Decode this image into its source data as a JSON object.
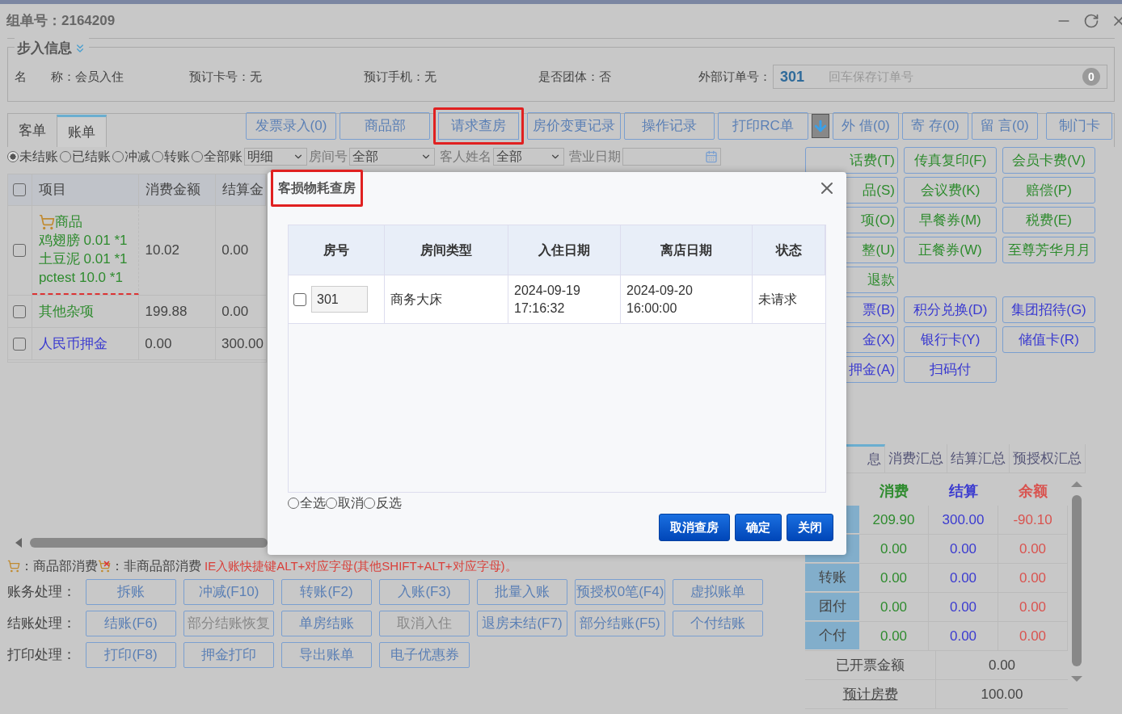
{
  "window": {
    "title": "组单号：2164209"
  },
  "info": {
    "legend": "步入信息",
    "fields": [
      {
        "label": "名　　称：",
        "value": "会员入住"
      },
      {
        "label": "预订卡号：",
        "value": "无"
      },
      {
        "label": "预订手机：",
        "value": "无"
      },
      {
        "label": "是否团体：",
        "value": "否"
      }
    ],
    "external_order": {
      "label": "外部订单号：",
      "room": "301",
      "placeholder": "回车保存订单号",
      "count": "0"
    }
  },
  "tabs": [
    {
      "label": "客单",
      "selected": false
    },
    {
      "label": "账单",
      "selected": true
    }
  ],
  "toolbar": [
    {
      "label": "发票录入(0)",
      "highlighted": false
    },
    {
      "label": "商品部",
      "highlighted": false
    },
    {
      "label": "请求查房",
      "highlighted": true
    },
    {
      "label": "房价变更记录",
      "highlighted": false
    },
    {
      "label": "操作记录",
      "highlighted": false
    },
    {
      "label": "打印RC单",
      "highlighted": false
    }
  ],
  "toolbar_right": [
    "外 借(0)",
    "寄 存(0)",
    "留 言(0)",
    "制门卡"
  ],
  "filters": {
    "radios": [
      {
        "label": "未结账",
        "selected": true
      },
      {
        "label": "已结账",
        "selected": false
      },
      {
        "label": "冲减",
        "selected": false
      },
      {
        "label": "转账",
        "selected": false
      },
      {
        "label": "全部账",
        "selected": false
      }
    ],
    "view": "明细",
    "room_label": "房间号",
    "room": "全部",
    "guest_label": "客人姓名",
    "guest": "全部",
    "date_label": "营业日期"
  },
  "bill_table": {
    "header_checked": false,
    "columns": [
      "项目",
      "消费金额",
      "结算金"
    ],
    "rows": [
      {
        "checked": false,
        "kind": "goods",
        "color": "#2e8b2e",
        "group": "商品",
        "lines": [
          "鸡翅膀 0.01 *1",
          "土豆泥 0.01 *1",
          "pctest 10.0 *1"
        ],
        "amount": "10.02",
        "settled": "0.00"
      },
      {
        "checked": false,
        "kind": "plain",
        "color": "#2e8b2e",
        "lines": [
          "其他杂项"
        ],
        "amount": "199.88",
        "settled": "0.00"
      },
      {
        "checked": false,
        "kind": "plain",
        "color": "#3a3ad0",
        "lines": [
          "人民币押金"
        ],
        "amount": "0.00",
        "settled": "300.00"
      }
    ]
  },
  "legend": {
    "goods": "：商品部消费",
    "non_goods": "：非商品部消费",
    "hint": "IE入账快捷键ALT+对应字母(其他SHIFT+ALT+对应字母)。"
  },
  "action_rows": [
    {
      "label": "账务处理：",
      "buttons": [
        {
          "label": "拆账",
          "disabled": false
        },
        {
          "label": "冲减(F10)",
          "disabled": false
        },
        {
          "label": "转账(F2)",
          "disabled": false
        },
        {
          "label": "入账(F3)",
          "disabled": false
        },
        {
          "label": "批量入账",
          "disabled": false
        },
        {
          "label": "预授权0笔(F4)",
          "disabled": false
        },
        {
          "label": "虚拟账单",
          "disabled": false
        }
      ]
    },
    {
      "label": "结账处理：",
      "buttons": [
        {
          "label": "结账(F6)",
          "disabled": false
        },
        {
          "label": "部分结账恢复",
          "disabled": true
        },
        {
          "label": "单房结账",
          "disabled": false
        },
        {
          "label": "取消入住",
          "disabled": true
        },
        {
          "label": "退房未结(F7)",
          "disabled": false
        },
        {
          "label": "部分结账(F5)",
          "disabled": false
        },
        {
          "label": "个付结账",
          "disabled": false
        }
      ]
    },
    {
      "label": "打印处理：",
      "buttons": [
        {
          "label": "打印(F8)",
          "disabled": false
        },
        {
          "label": "押金打印",
          "disabled": false
        },
        {
          "label": "导出账单",
          "disabled": false
        },
        {
          "label": "电子优惠券",
          "disabled": false
        }
      ]
    }
  ],
  "quick_buttons": [
    [
      {
        "label": "话费(T)",
        "kind": "charge"
      },
      {
        "label": "传真复印(F)",
        "kind": "charge"
      },
      {
        "label": "会员卡费(V)",
        "kind": "charge"
      }
    ],
    [
      {
        "label": "品(S)",
        "kind": "charge"
      },
      {
        "label": "会议费(K)",
        "kind": "charge"
      },
      {
        "label": "赔偿(P)",
        "kind": "charge"
      }
    ],
    [
      {
        "label": "项(O)",
        "kind": "charge"
      },
      {
        "label": "早餐券(M)",
        "kind": "charge"
      },
      {
        "label": "税费(E)",
        "kind": "charge"
      }
    ],
    [
      {
        "label": "整(U)",
        "kind": "charge"
      },
      {
        "label": "正餐券(W)",
        "kind": "charge"
      },
      {
        "label": "至尊芳华月月",
        "kind": "charge"
      }
    ],
    [
      {
        "label": "退款",
        "kind": "charge"
      }
    ],
    [
      {
        "label": "票(B)",
        "kind": "payment"
      },
      {
        "label": "积分兑换(D)",
        "kind": "payment"
      },
      {
        "label": "集团招待(G)",
        "kind": "payment"
      }
    ],
    [
      {
        "label": "金(X)",
        "kind": "payment"
      },
      {
        "label": "银行卡(Y)",
        "kind": "payment"
      },
      {
        "label": "储值卡(R)",
        "kind": "payment"
      }
    ],
    [
      {
        "label": "押金(A)",
        "kind": "payment"
      },
      {
        "label": "扫码付",
        "kind": "payment"
      }
    ]
  ],
  "summary": {
    "tabs": [
      {
        "label": "息",
        "selected": true
      },
      {
        "label": "消费汇总",
        "selected": false
      },
      {
        "label": "结算汇总",
        "selected": false
      },
      {
        "label": "预授权汇总",
        "selected": false
      }
    ],
    "columns": [
      "消费",
      "结算",
      "余额"
    ],
    "rows": [
      {
        "cells": [
          "209.90",
          "300.00",
          "-90.10"
        ]
      },
      {
        "cells": [
          "0.00",
          "0.00",
          "0.00"
        ]
      },
      {
        "label": "转账",
        "cells": [
          "0.00",
          "0.00",
          "0.00"
        ]
      },
      {
        "label": "团付",
        "cells": [
          "0.00",
          "0.00",
          "0.00"
        ]
      },
      {
        "label": "个付",
        "cells": [
          "0.00",
          "0.00",
          "0.00"
        ]
      }
    ],
    "totals": [
      {
        "label": "已开票金额",
        "value": "0.00",
        "link": false
      },
      {
        "label": "预计房费",
        "value": "100.00",
        "link": true
      }
    ]
  },
  "dialog": {
    "title": "客损物耗查房",
    "title_highlighted": true,
    "columns": [
      "房号",
      "房间类型",
      "入住日期",
      "离店日期",
      "状态"
    ],
    "rows": [
      {
        "checked": false,
        "room": "301",
        "type": "商务大床",
        "checkin": [
          "2024-09-19",
          "17:16:32"
        ],
        "checkout": [
          "2024-09-20",
          "16:00:00"
        ],
        "status": "未请求"
      }
    ],
    "radios": [
      {
        "label": "全选",
        "selected": false
      },
      {
        "label": "取消",
        "selected": false
      },
      {
        "label": "反选",
        "selected": false
      }
    ],
    "buttons": [
      "取消查房",
      "确定",
      "关闭"
    ]
  }
}
